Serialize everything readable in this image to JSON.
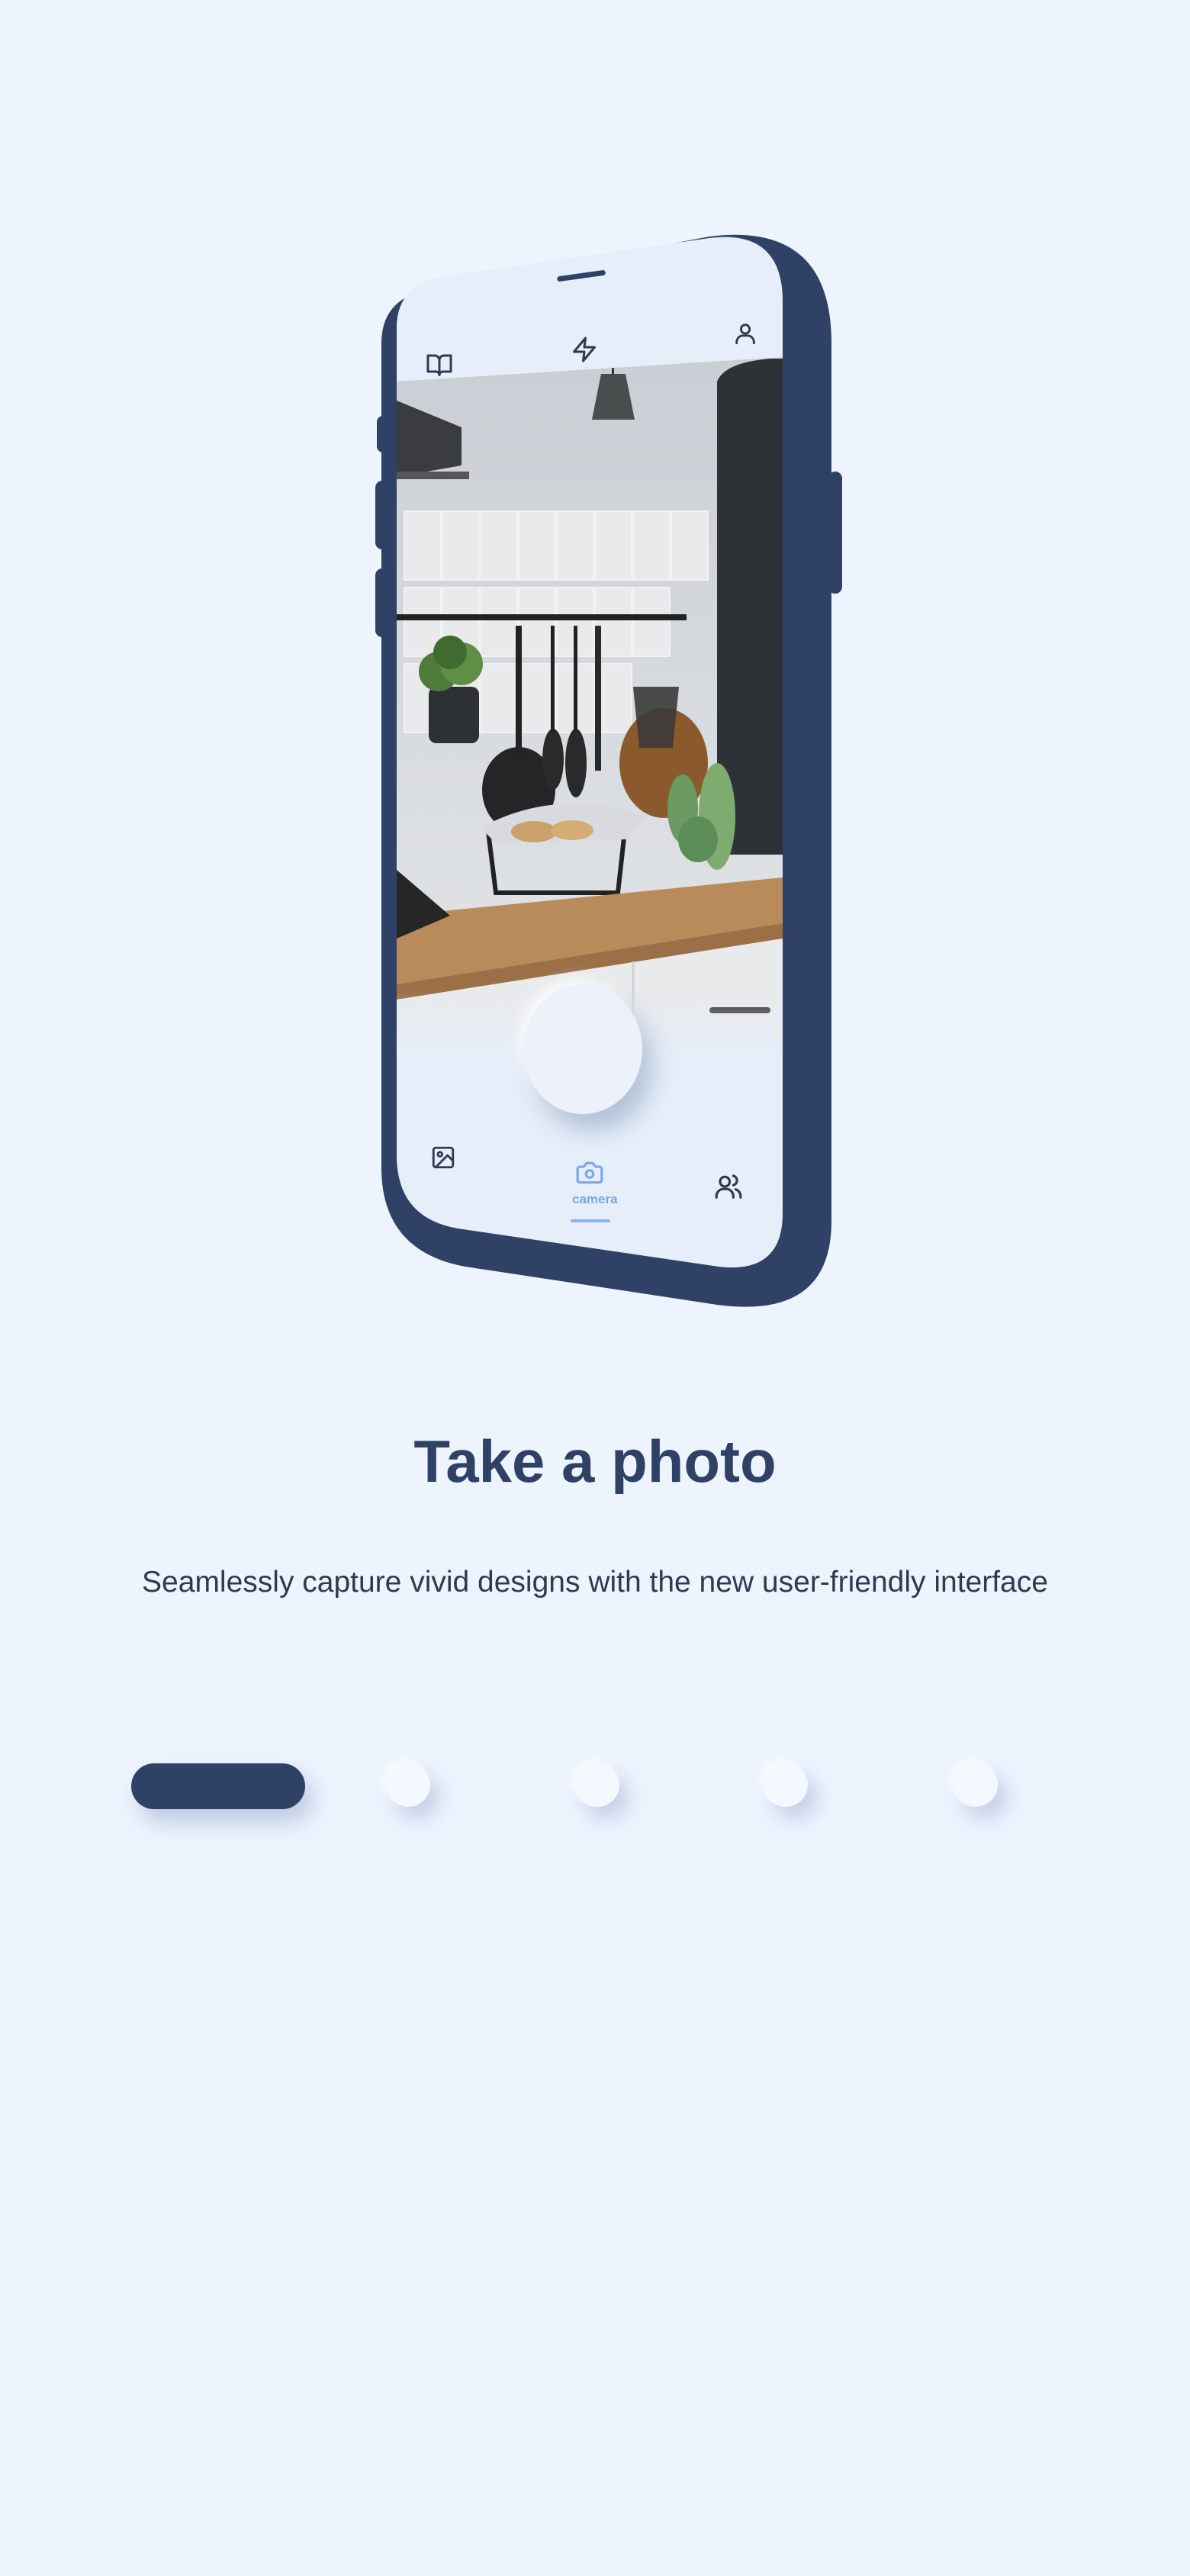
{
  "phone": {
    "top_bar": {
      "left_icon": "book-open-icon",
      "center_icon": "flash-icon",
      "right_icon": "user-icon"
    },
    "photo_description_icon": "kitchen-photo",
    "bottom_nav": {
      "items": [
        {
          "icon": "image-icon",
          "label": ""
        },
        {
          "icon": "camera-icon",
          "label": "camera",
          "active": true
        },
        {
          "icon": "users-icon",
          "label": ""
        }
      ]
    }
  },
  "onboarding": {
    "title": "Take a photo",
    "subtitle": "Seamlessly capture vivid designs with the new user-friendly interface"
  },
  "pager": {
    "total": 5,
    "active_index": 0
  },
  "colors": {
    "background": "#edf4fe",
    "frame": "#2f4266",
    "accent": "#7aa6ee",
    "title": "#2f4266",
    "text": "#2f3a52"
  }
}
